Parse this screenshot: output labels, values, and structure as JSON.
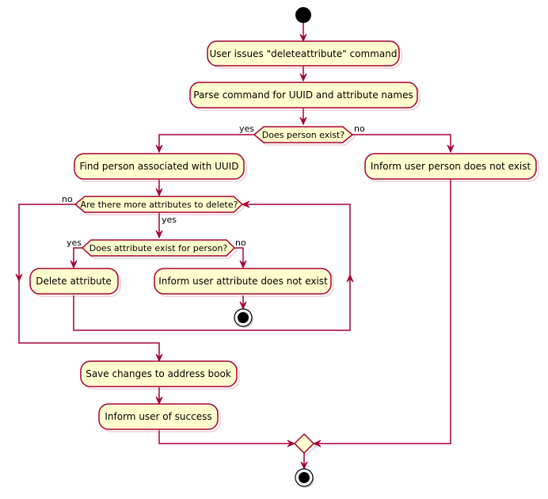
{
  "diagram": {
    "type": "activity",
    "colors": {
      "line": "#A80036",
      "fill": "#FEFECE",
      "node": "#000000"
    },
    "actions": {
      "issue": "User issues \"deleteattribute\" command",
      "parse": "Parse command for UUID and attribute names",
      "find": "Find person associated with UUID",
      "inform_person": "Inform user person does not exist",
      "delete": "Delete attribute",
      "inform_attr": "Inform user attribute does not exist",
      "save": "Save changes to address book",
      "success": "Inform user of success"
    },
    "decisions": {
      "person_exists": "Does person exist?",
      "more_attrs": "Are there more attributes to delete?",
      "attr_exists": "Does attribute exist for person?"
    },
    "labels": {
      "yes": "yes",
      "no": "no"
    }
  }
}
